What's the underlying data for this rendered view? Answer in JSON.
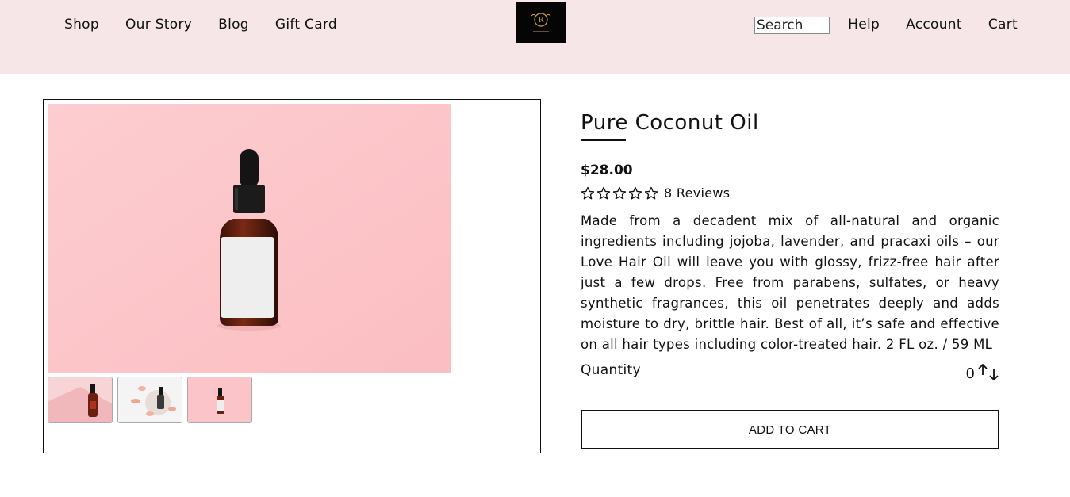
{
  "nav": {
    "left": [
      "Shop",
      "Our Story",
      "Blog",
      "Gift Card"
    ],
    "right": [
      "Help",
      "Account",
      "Cart"
    ],
    "search_placeholder": "Search"
  },
  "product": {
    "title": "Pure Coconut Oil",
    "price": "$28.00",
    "rating": {
      "stars": 0,
      "max": 5
    },
    "reviews": "8 Reviews",
    "description": "Made from a decadent mix of all-natural and organic ingredients including jojoba, lavender, and pracaxi oils – our Love Hair Oil will leave you with glossy, frizz-free hair after just a few drops. Free from parabens, sulfates, or heavy synthetic fragrances, this oil penetrates deeply and adds moisture to dry, brittle hair. Best of all, it’s safe and effective on all hair types including color-treated hair. 2 FL oz. / 59 ML",
    "quantity_label": "Quantity",
    "quantity": "0",
    "add_to_cart": "ADD TO CART"
  },
  "colors": {
    "header_bg": "#f6e6e7",
    "image_bg": "#fdc6c9",
    "logo_bg": "#050505",
    "logo_gold": "#c9a04a"
  }
}
